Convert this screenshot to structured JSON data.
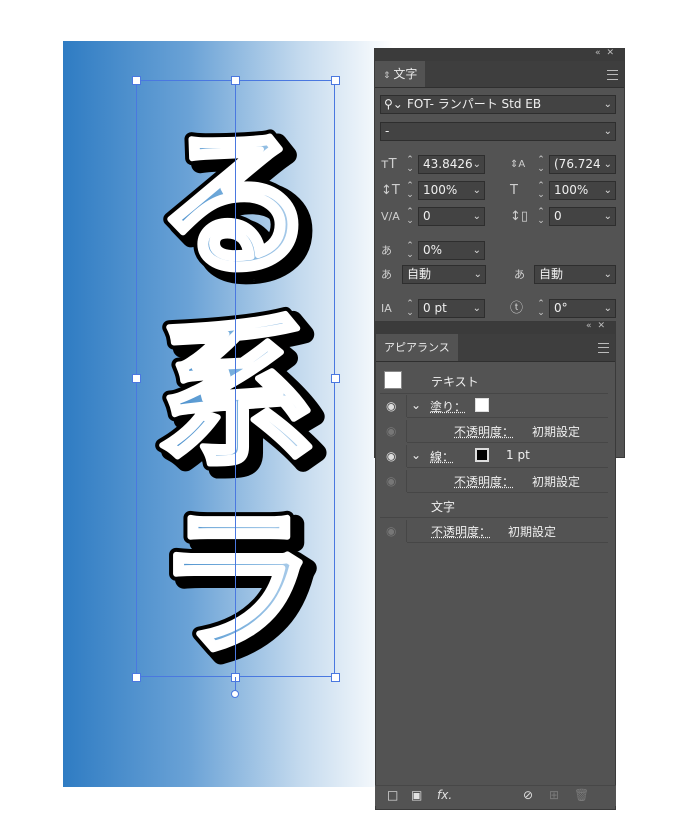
{
  "artwork": {
    "glyphs": [
      "る",
      "系",
      "ラ"
    ]
  },
  "character_panel": {
    "tab_label": "文字",
    "font_family": "FOT- ランパート Std EB",
    "font_style": "-",
    "font_size": "43.8426",
    "leading": "(76.724",
    "vertical_scale": "100%",
    "horizontal_scale": "100%",
    "kerning": "0",
    "tracking": "0",
    "tsume": "0%",
    "aki_left": "自動",
    "aki_right": "自動",
    "baseline_shift": "0 pt",
    "rotation": "0°"
  },
  "appearance_panel": {
    "tab_label": "アピアランス",
    "rows": {
      "object": "テキスト",
      "fill_label": "塗り：",
      "fill_opacity_label": "不透明度：",
      "fill_opacity_value": "初期設定",
      "stroke_label": "線：",
      "stroke_weight": "1 pt",
      "stroke_opacity_label": "不透明度：",
      "stroke_opacity_value": "初期設定",
      "character": "文字",
      "opacity_label": "不透明度：",
      "opacity_value": "初期設定"
    },
    "footer_icons": [
      "new-stroke-icon",
      "new-fill-icon",
      "fx-icon",
      "clear-appearance-icon",
      "duplicate-item-icon",
      "delete-item-icon"
    ],
    "fx_label": "fx."
  }
}
